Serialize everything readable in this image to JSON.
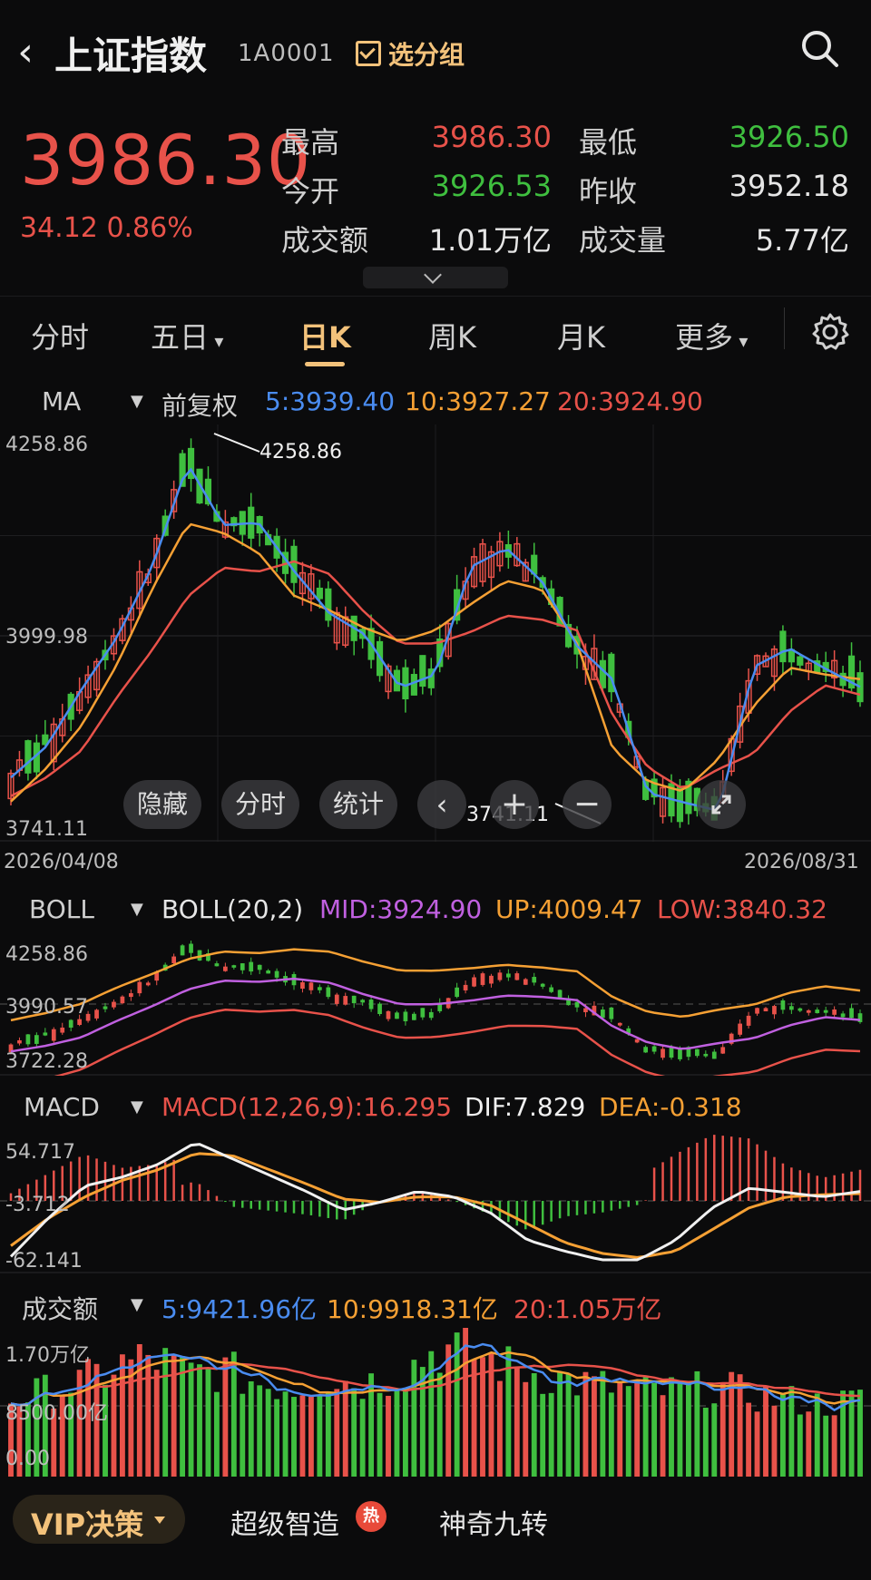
{
  "header": {
    "title": "上证指数",
    "code": "1A0001",
    "select_group": "选分组"
  },
  "quote": {
    "price": "3986.30",
    "change": "34.12",
    "change_pct": "0.86%",
    "rows": [
      [
        {
          "label": "最高",
          "value": "3986.30",
          "color": "red"
        },
        {
          "label": "最低",
          "value": "3926.50",
          "color": "green"
        }
      ],
      [
        {
          "label": "今开",
          "value": "3926.53",
          "color": "green"
        },
        {
          "label": "昨收",
          "value": "3952.18",
          "color": "white"
        }
      ],
      [
        {
          "label": "成交额",
          "value": "1.01万亿",
          "color": "white"
        },
        {
          "label": "成交量",
          "value": "5.77亿",
          "color": "white"
        }
      ]
    ]
  },
  "tabs": [
    {
      "label": "分时",
      "active": false
    },
    {
      "label": "五日",
      "active": false,
      "dropdown": true
    },
    {
      "label": "日K",
      "active": true
    },
    {
      "label": "周K",
      "active": false
    },
    {
      "label": "月K",
      "active": false
    },
    {
      "label": "更多",
      "active": false,
      "dropdown": true
    }
  ],
  "ma": {
    "indicator": "MA",
    "adjust": "前复权",
    "ma5": "5:3939.40",
    "ma10": "10:3927.27",
    "ma20": "20:3924.90",
    "y_top": "4258.86",
    "y_mid": "3999.98",
    "y_bottom": "3741.11",
    "high_annot": "4258.86",
    "low_annot": "3741.11",
    "date_start": "2026/04/08",
    "date_end": "2026/08/31",
    "buttons": [
      "隐藏",
      "分时",
      "统计"
    ]
  },
  "boll": {
    "indicator": "BOLL",
    "param": "BOLL(20,2)",
    "mid": "MID:3924.90",
    "up": "UP:4009.47",
    "low": "LOW:3840.32",
    "y_top": "4258.86",
    "y_mid": "3990.57",
    "y_bottom": "3722.28"
  },
  "macd": {
    "indicator": "MACD",
    "param": "MACD(12,26,9):16.295",
    "dif": "DIF:7.829",
    "dea": "DEA:-0.318",
    "y_top": "54.717",
    "y_mid": "-3.712",
    "y_bottom": "-62.141"
  },
  "volume": {
    "indicator": "成交额",
    "ma5": "5:9421.96亿",
    "ma10": "10:9918.31亿",
    "ma20": "20:1.05万亿",
    "y_top": "1.70万亿",
    "y_mid": "8500.00亿",
    "y_bottom": "0.00"
  },
  "bottom": {
    "vip": "VIP决策",
    "link1": "超级智造",
    "hot": "热",
    "link2": "神奇九转"
  },
  "colors": {
    "up": "#e8524a",
    "down": "#3fbf3f",
    "ma5": "#4a8cf0",
    "ma10": "#f5a034",
    "ma20": "#e8524a",
    "boll_mid": "#c060e0",
    "accent": "#f3c27b"
  },
  "chart_data": {
    "type": "candlestick",
    "x": [
      "2026/04/08",
      "2026/08/31"
    ],
    "series": [
      {
        "name": "MA5",
        "values": [
          3817,
          3857,
          3931,
          3998,
          4090,
          4222,
          4143,
          4146,
          4084,
          4029,
          4002,
          3933,
          3950,
          4089,
          4113,
          4071,
          3987,
          3944,
          3797,
          3785,
          3774,
          3960,
          3984,
          3958,
          3934
        ]
      },
      {
        "name": "MA10",
        "values": [
          3786,
          3829,
          3884,
          3963,
          4061,
          4145,
          4133,
          4107,
          4052,
          4033,
          4010,
          3993,
          4007,
          4041,
          4071,
          4060,
          3990,
          3855,
          3812,
          3799,
          3841,
          3910,
          3959,
          3950,
          3944
        ]
      },
      {
        "name": "MA20",
        "values": [
          3793,
          3817,
          3852,
          3921,
          3982,
          4051,
          4088,
          4083,
          4096,
          4080,
          4030,
          3990,
          3990,
          4005,
          4026,
          4021,
          4007,
          3898,
          3830,
          3802,
          3828,
          3848,
          3902,
          3936,
          3924
        ]
      }
    ],
    "ylim": [
      "3741.11",
      "4258.86"
    ]
  }
}
